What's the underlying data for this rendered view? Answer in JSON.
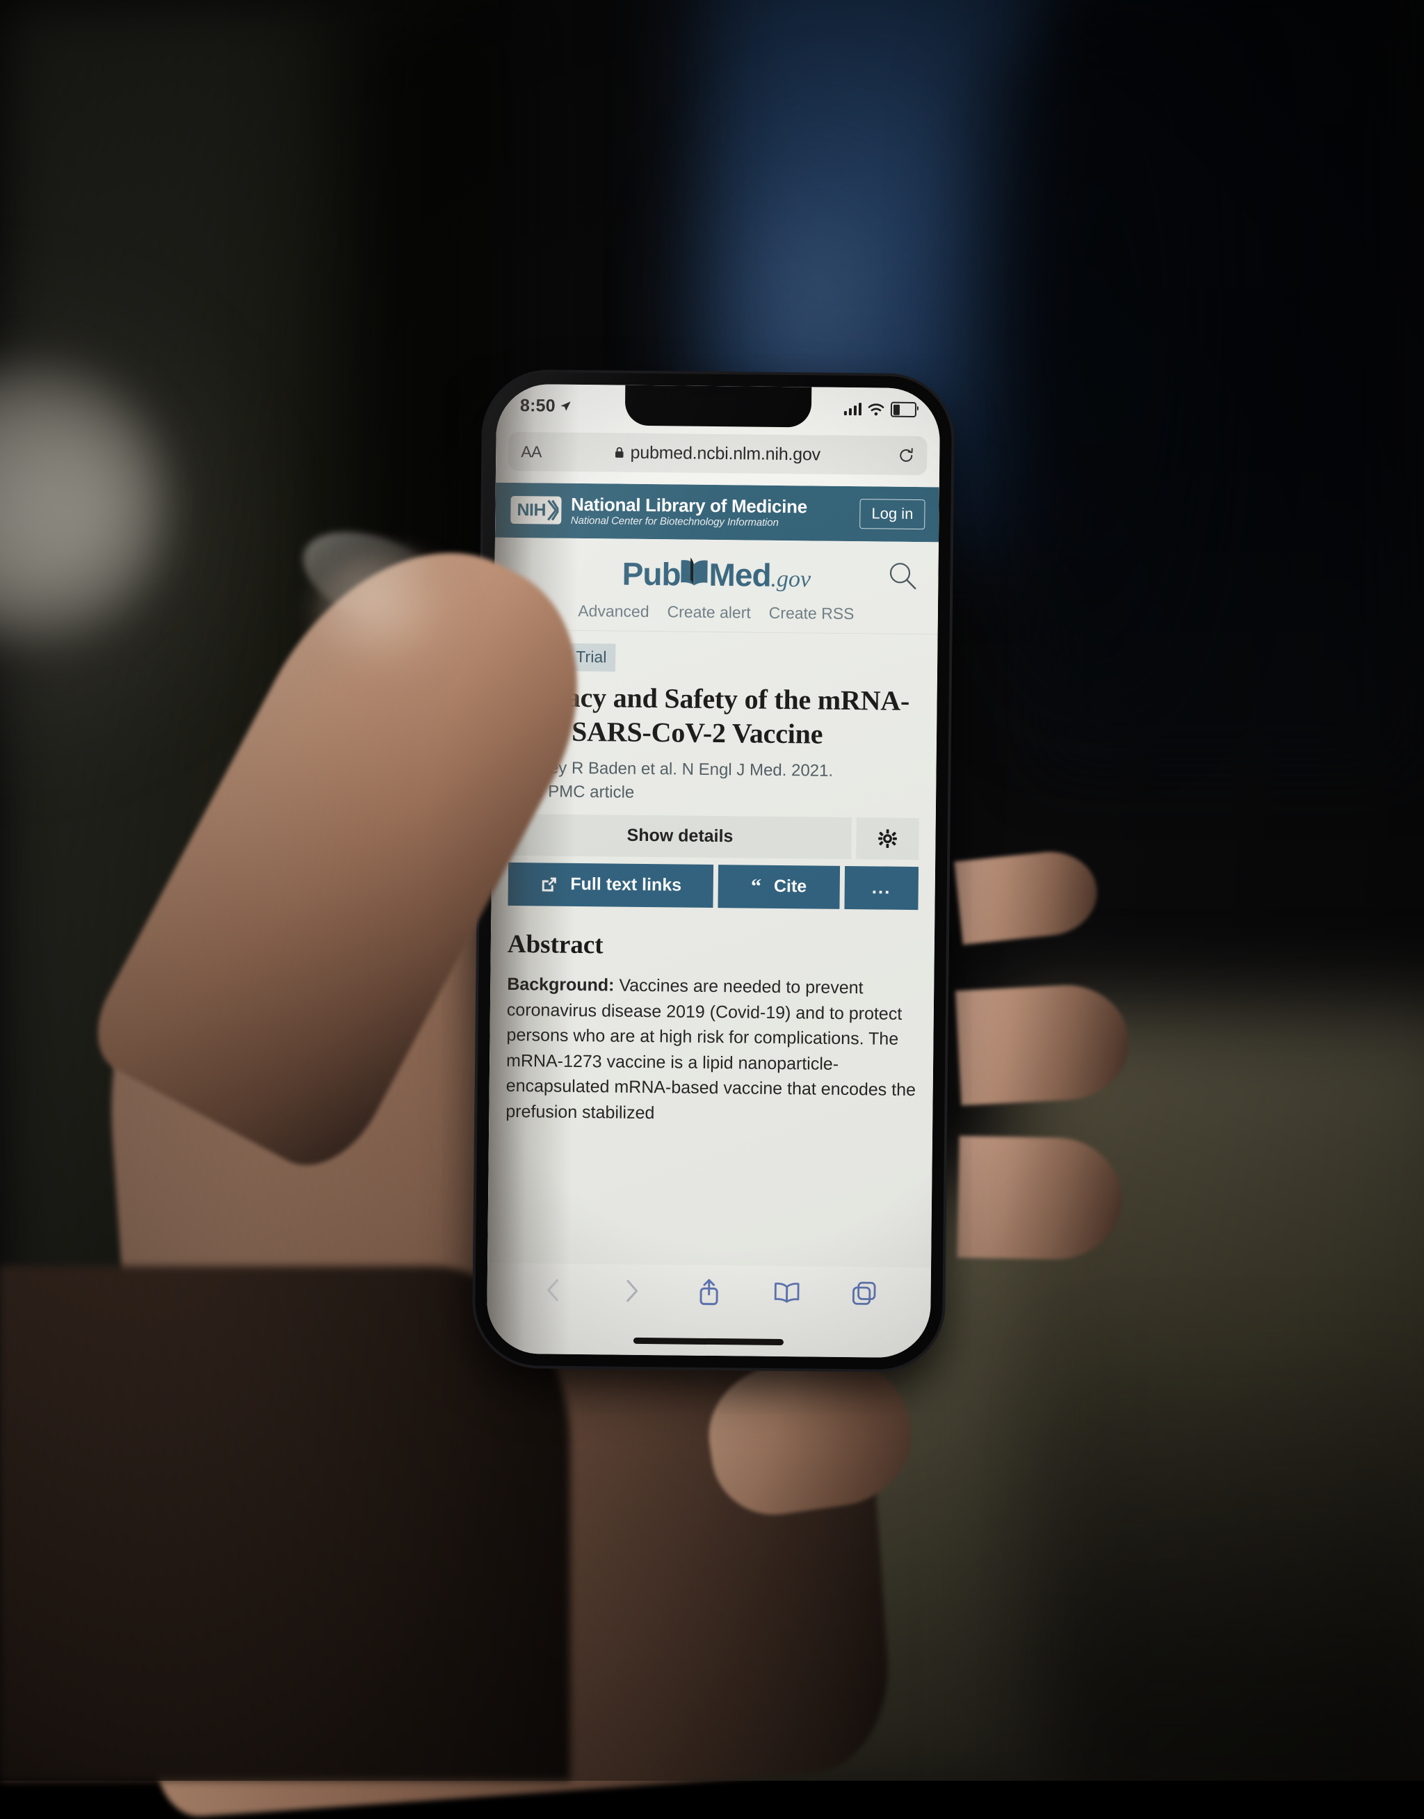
{
  "status_bar": {
    "time": "8:50",
    "location_icon": "location-arrow-icon",
    "signal_icon": "cellular-signal-icon",
    "wifi_icon": "wifi-icon",
    "battery_icon": "battery-low-icon"
  },
  "browser": {
    "text_size_button": "AA",
    "lock_icon": "lock-icon",
    "url": "pubmed.ncbi.nlm.nih.gov",
    "reload_icon": "reload-icon",
    "toolbar": {
      "back_icon": "chevron-left-icon",
      "forward_icon": "chevron-right-icon",
      "share_icon": "share-icon",
      "bookmarks_icon": "book-icon",
      "tabs_icon": "tabs-icon"
    }
  },
  "nih_header": {
    "logo_text": "NIH",
    "title": "National Library of Medicine",
    "subtitle": "National Center for Biotechnology Information",
    "login_label": "Log in"
  },
  "pubmed_header": {
    "logo_pub": "Pub",
    "logo_med": "Med",
    "logo_gov": ".gov",
    "search_icon": "search-icon",
    "links": [
      "Advanced",
      "Create alert",
      "Create RSS"
    ]
  },
  "article": {
    "badge": "Clinical Trial",
    "title": "Efficacy and Safety of the mRNA-1273 SARS-CoV-2 Vaccine",
    "authors": "Lindsey R Baden et al. N Engl J Med. 2021.",
    "free_text": "Free PMC article",
    "show_details_label": "Show details",
    "settings_icon": "gear-icon",
    "buttons": [
      {
        "label": "Full text links",
        "icon": "external-link-icon"
      },
      {
        "label": "Cite",
        "icon": "quote-icon"
      },
      {
        "label": "...",
        "icon": "ellipsis-icon"
      }
    ],
    "abstract_heading": "Abstract",
    "abstract_label": "Background:",
    "abstract_text": " Vaccines are needed to prevent coronavirus disease 2019 (Covid-19) and to protect persons who are at high risk for complications. The mRNA-1273 vaccine is a lipid nanoparticle-encapsulated mRNA-based vaccine that encodes the prefusion stabilized"
  },
  "colors": {
    "nih_blue": "#2c5d74",
    "button_blue": "#2a5d7c",
    "badge_bg": "#ccd6d9",
    "page_bg": "#eceeea"
  }
}
